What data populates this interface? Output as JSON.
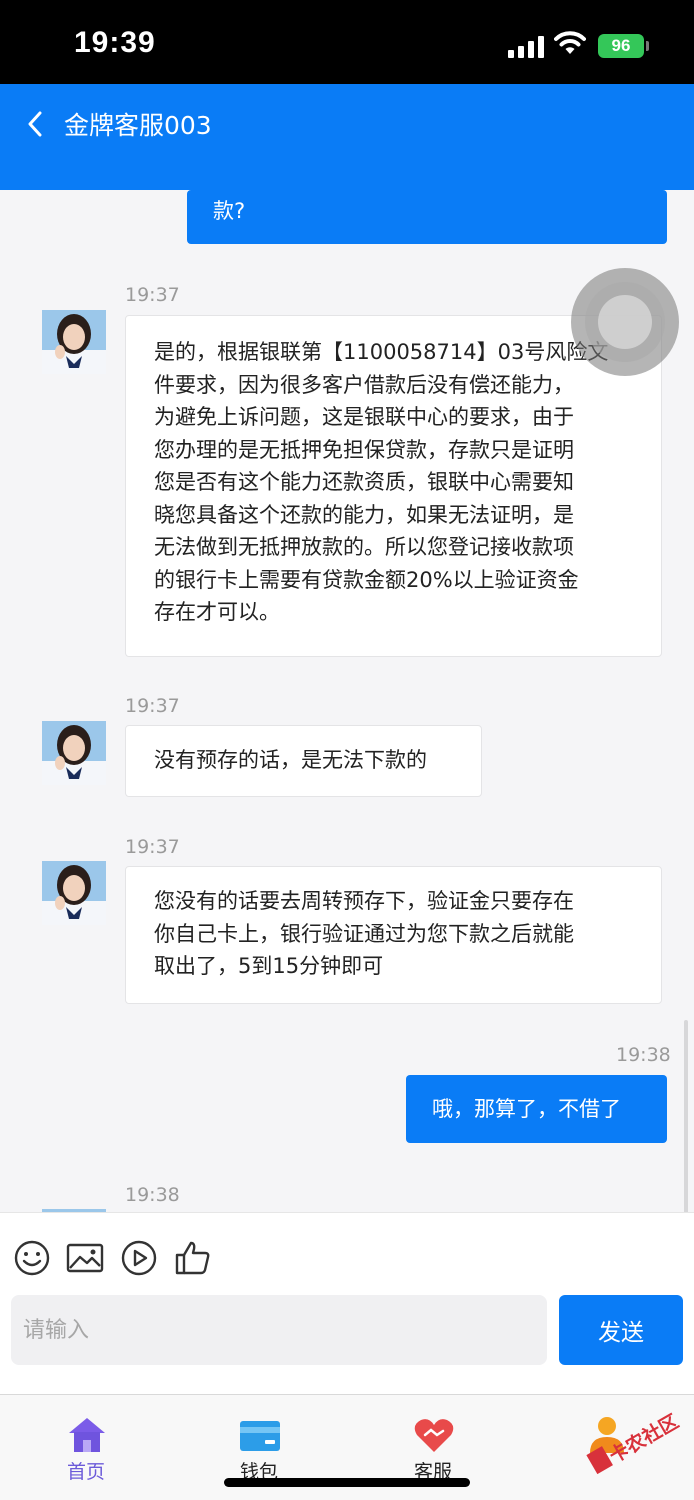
{
  "status_bar": {
    "time": "19:39",
    "battery": "96"
  },
  "nav": {
    "title": "金牌客服003"
  },
  "messages": [
    {
      "side": "out",
      "lines": [
        "款?"
      ]
    },
    {
      "side": "in",
      "time": "19:37",
      "lines": [
        "是的，根据银联第【1100058714】03号风险文",
        "件要求，因为很多客户借款后没有偿还能力，",
        "为避免上诉问题，这是银联中心的要求，由于",
        "您办理的是无抵押免担保贷款，存款只是证明",
        "您是否有这个能力还款资质，银联中心需要知",
        "晓您具备这个还款的能力，如果无法证明，是",
        "无法做到无抵押放款的。所以您登记接收款项",
        "的银行卡上需要有贷款金额20%以上验证资金",
        "存在才可以。"
      ]
    },
    {
      "side": "in",
      "time": "19:37",
      "lines": [
        "没有预存的话，是无法下款的"
      ]
    },
    {
      "side": "in",
      "time": "19:37",
      "lines": [
        "您没有的话要去周转预存下，验证金只要存在",
        "你自己卡上，银行验证通过为您下款之后就能",
        "取出了，5到15分钟即可"
      ]
    },
    {
      "side": "out",
      "time": "19:38",
      "lines": [
        "哦，那算了，不借了"
      ]
    },
    {
      "side": "in",
      "time": "19:38",
      "lines": []
    }
  ],
  "composer": {
    "tools": [
      "emoji-icon",
      "image-icon",
      "play-icon",
      "thumbs-up-icon"
    ],
    "input_placeholder": "请输入",
    "send_label": "发送"
  },
  "tabs": [
    {
      "label": "首页",
      "icon": "home-icon",
      "active": true
    },
    {
      "label": "钱包",
      "icon": "wallet-icon",
      "active": false
    },
    {
      "label": "客服",
      "icon": "customer-service-icon",
      "active": false
    },
    {
      "label": "我的",
      "icon": "profile-icon",
      "active": false
    }
  ],
  "watermark": {
    "text": "卡农社区"
  },
  "colors": {
    "primary": "#0a7cf6",
    "active_tab": "#6c5bd9",
    "status_bar": "#000000",
    "battery": "#34c759"
  }
}
